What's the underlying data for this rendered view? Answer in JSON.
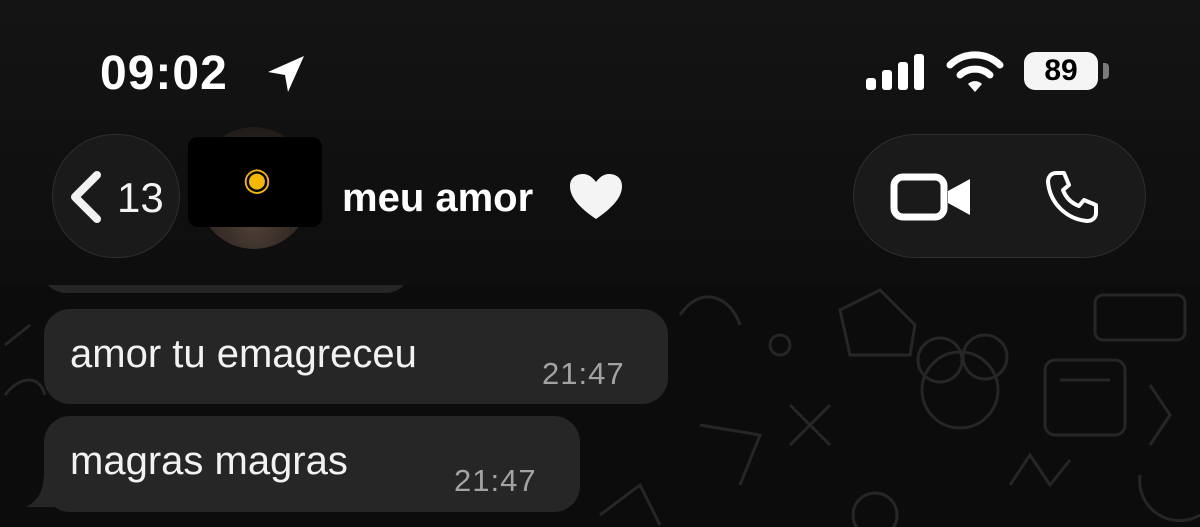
{
  "status_bar": {
    "time": "09:02",
    "battery_level": "89",
    "location_icon": "location-arrow-icon",
    "signal_icon": "cellular-signal-icon",
    "wifi_icon": "wifi-icon"
  },
  "header": {
    "back_count": "13",
    "back_icon": "chevron-left-icon",
    "contact_name": "meu amor",
    "name_icon": "white-heart-icon",
    "avatar_sticker_icon": "partying-face-icon",
    "video_call_icon": "video-camera-icon",
    "voice_call_icon": "phone-icon"
  },
  "messages": [
    {
      "text": "amor tu emagreceu",
      "time": "21:47"
    },
    {
      "text": "magras magras",
      "time": "21:47"
    }
  ],
  "colors": {
    "background": "#0a0a0a",
    "header_background": "#121212",
    "bubble": "#262626",
    "timestamp": "#a3a3a3",
    "pill_button": "#1a1a1a"
  }
}
